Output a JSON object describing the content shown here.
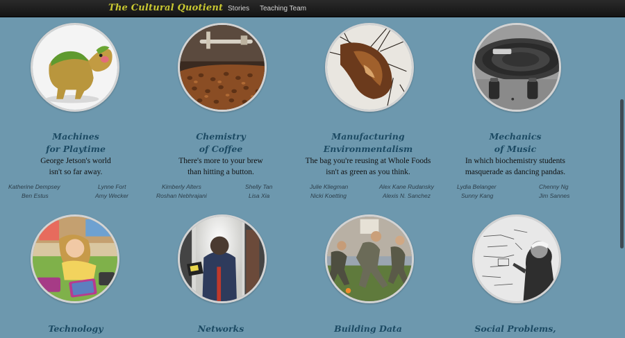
{
  "nav": {
    "brand": "The Cultural Quotient",
    "links": [
      "Stories",
      "Teaching Team"
    ]
  },
  "colors": {
    "background": "#6d98ae",
    "navbar": "#1b1b1b",
    "brand": "#c9c832",
    "title": "#1c4a63"
  },
  "stories": [
    {
      "title1": "Machines",
      "title2": "for Playtime",
      "desc1": "George Jetson's world",
      "desc2": "isn't so far away.",
      "authors": [
        "Katherine Dempsey",
        "Lynne Fort",
        "Ben Estus",
        "Amy Wecker"
      ],
      "image": "robot-dinosaur-toy"
    },
    {
      "title1": "Chemistry",
      "title2": "of Coffee",
      "desc1": "There's more to your brew",
      "desc2": "than hitting a button.",
      "authors": [
        "Kimberly Alters",
        "Shelly Tan",
        "Roshan Nebhrajani",
        "Lisa Xia"
      ],
      "image": "coffee-roaster"
    },
    {
      "title1": "Manufacturing",
      "title2": "Environmentalism",
      "desc1": "The bag you're reusing at Whole Foods",
      "desc2": "isn't as green as you think.",
      "authors": [
        "Julie Kliegman",
        "Alex Kane Rudansky",
        "Nicki Koetting",
        "Alexis N. Sanchez"
      ],
      "image": "hair-and-branches"
    },
    {
      "title1": "Mechanics",
      "title2": "of Music",
      "desc1": "In which biochemistry students",
      "desc2": "masquerade as dancing pandas.",
      "authors": [
        "Lydia Belanger",
        "Chenny Ng",
        "Sunny Kang",
        "Jim Sannes"
      ],
      "image": "turntable"
    },
    {
      "title1": "Technology",
      "image": "child-with-tablets"
    },
    {
      "title1": "Networks",
      "image": "astronaut-in-doorway"
    },
    {
      "title1": "Building Data",
      "image": "people-running"
    },
    {
      "title1": "Social Problems,",
      "image": "whiteboard-writer"
    }
  ]
}
